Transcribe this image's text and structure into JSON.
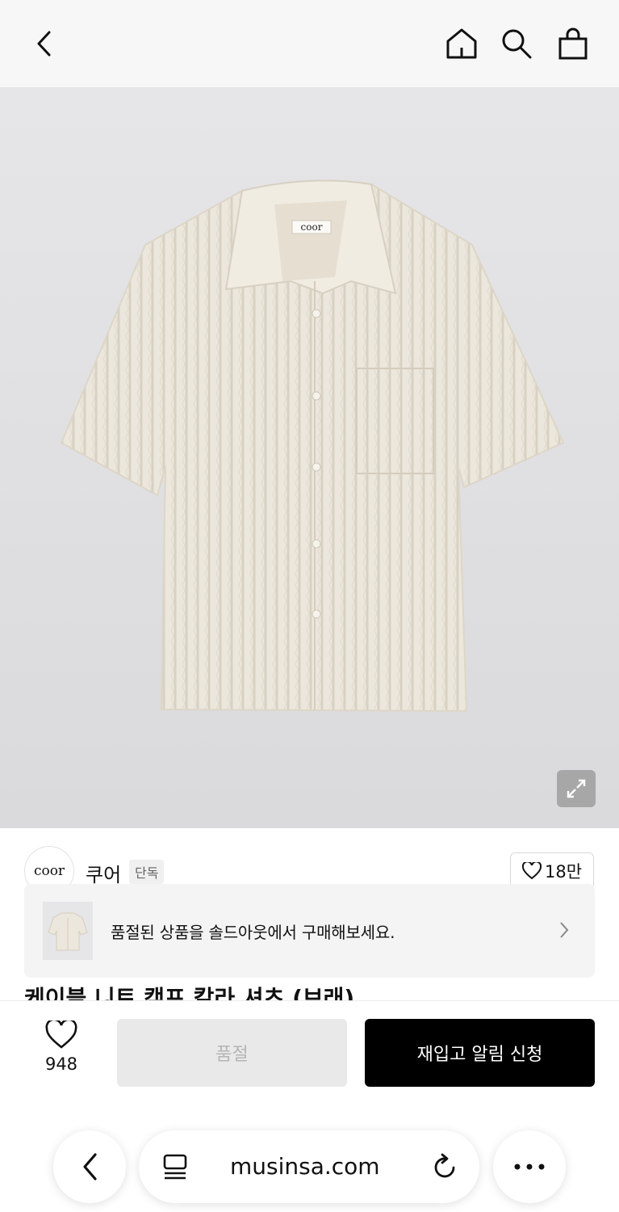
{
  "topbar": {
    "icons": [
      "back-icon",
      "home-icon",
      "search-icon",
      "shopping-bag-icon"
    ]
  },
  "product": {
    "image_icon": "shirt-image",
    "expand_icon": "expand-icon",
    "title": "케이블 니트 캠프 칼라 셔츠 (브래)"
  },
  "brand": {
    "logo_text": "coor",
    "name": "쿠어",
    "badge": "단독",
    "like_count": "18만"
  },
  "soldout_banner": {
    "text": "품절된 상품을 솔드아웃에서 구매해보세요.",
    "chevron_icon": "chevron-right-icon"
  },
  "actions": {
    "wish_count": "948",
    "soldout_label": "품절",
    "restock_label": "재입고 알림 신청"
  },
  "browser": {
    "url": "musinsa.com",
    "icons": [
      "back-icon",
      "tabs-icon",
      "reload-icon",
      "more-icon"
    ]
  },
  "colors": {
    "primary_button": "#000000",
    "disabled_button": "#e9e9e9",
    "hero_background": "#e0e0e2",
    "shirt": "#ece7dc"
  }
}
